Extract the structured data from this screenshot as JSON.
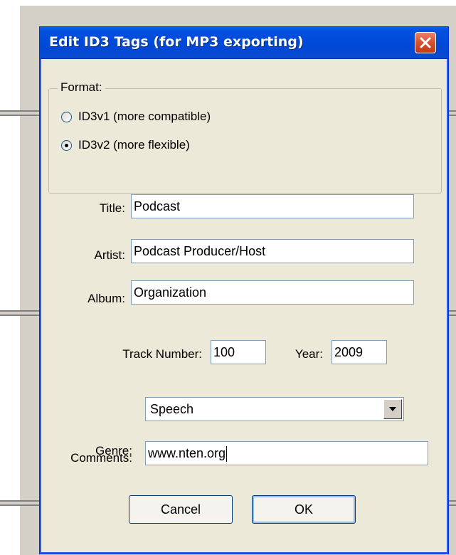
{
  "dialog": {
    "title": "Edit ID3 Tags (for MP3 exporting)",
    "close_icon": "close-x-icon"
  },
  "format": {
    "label": "Format:",
    "options": [
      {
        "label": "ID3v1 (more compatible)",
        "checked": false
      },
      {
        "label": "ID3v2 (more flexible)",
        "checked": true
      }
    ]
  },
  "fields": {
    "title": {
      "label": "Title:",
      "value": "Podcast"
    },
    "artist": {
      "label": "Artist:",
      "value": "Podcast Producer/Host"
    },
    "album": {
      "label": "Album:",
      "value": "Organization"
    },
    "track_number": {
      "label": "Track Number:",
      "value": "100"
    },
    "year": {
      "label": "Year:",
      "value": "2009"
    },
    "genre": {
      "label": "Genre:",
      "value": "Speech"
    },
    "comments": {
      "label": "Comments:",
      "value": "www.nten.org"
    }
  },
  "buttons": {
    "cancel": "Cancel",
    "ok": "OK"
  },
  "colors": {
    "titlebar": "#0048d6",
    "close_button": "#d6502c",
    "dialog_face": "#ece9d8"
  }
}
